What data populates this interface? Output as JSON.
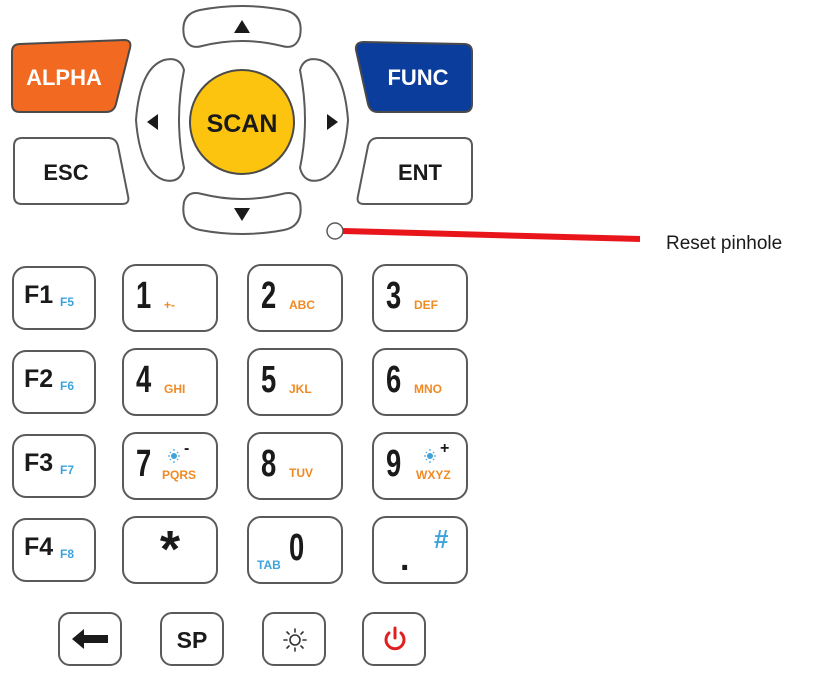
{
  "top": {
    "alpha": "ALPHA",
    "func": "FUNC",
    "scan": "SCAN",
    "esc": "ESC",
    "ent": "ENT"
  },
  "callout": {
    "label": "Reset pinhole"
  },
  "fkeys": [
    {
      "main": "F1",
      "sub": "F5"
    },
    {
      "main": "F2",
      "sub": "F6"
    },
    {
      "main": "F3",
      "sub": "F7"
    },
    {
      "main": "F4",
      "sub": "F8"
    }
  ],
  "numkeys": [
    {
      "main": "1",
      "sub": "+-"
    },
    {
      "main": "2",
      "sub": "ABC"
    },
    {
      "main": "3",
      "sub": "DEF"
    },
    {
      "main": "4",
      "sub": "GHI"
    },
    {
      "main": "5",
      "sub": "JKL"
    },
    {
      "main": "6",
      "sub": "MNO"
    },
    {
      "main": "7",
      "sub": "PQRS",
      "extra": "-"
    },
    {
      "main": "8",
      "sub": "TUV"
    },
    {
      "main": "9",
      "sub": "WXYZ",
      "extra": "+"
    }
  ],
  "bottomrow": {
    "star": "*",
    "zero": "0",
    "tab": "TAB",
    "dot": ".",
    "hash": "#",
    "sp": "SP"
  },
  "colors": {
    "alpha": "#f26a21",
    "func": "#0a3d9c",
    "scan": "#fcc40e",
    "sub_orange": "#f08a24",
    "sub_blue": "#3ea3dc",
    "power": "#e02020",
    "callout_line": "#e8161a"
  }
}
